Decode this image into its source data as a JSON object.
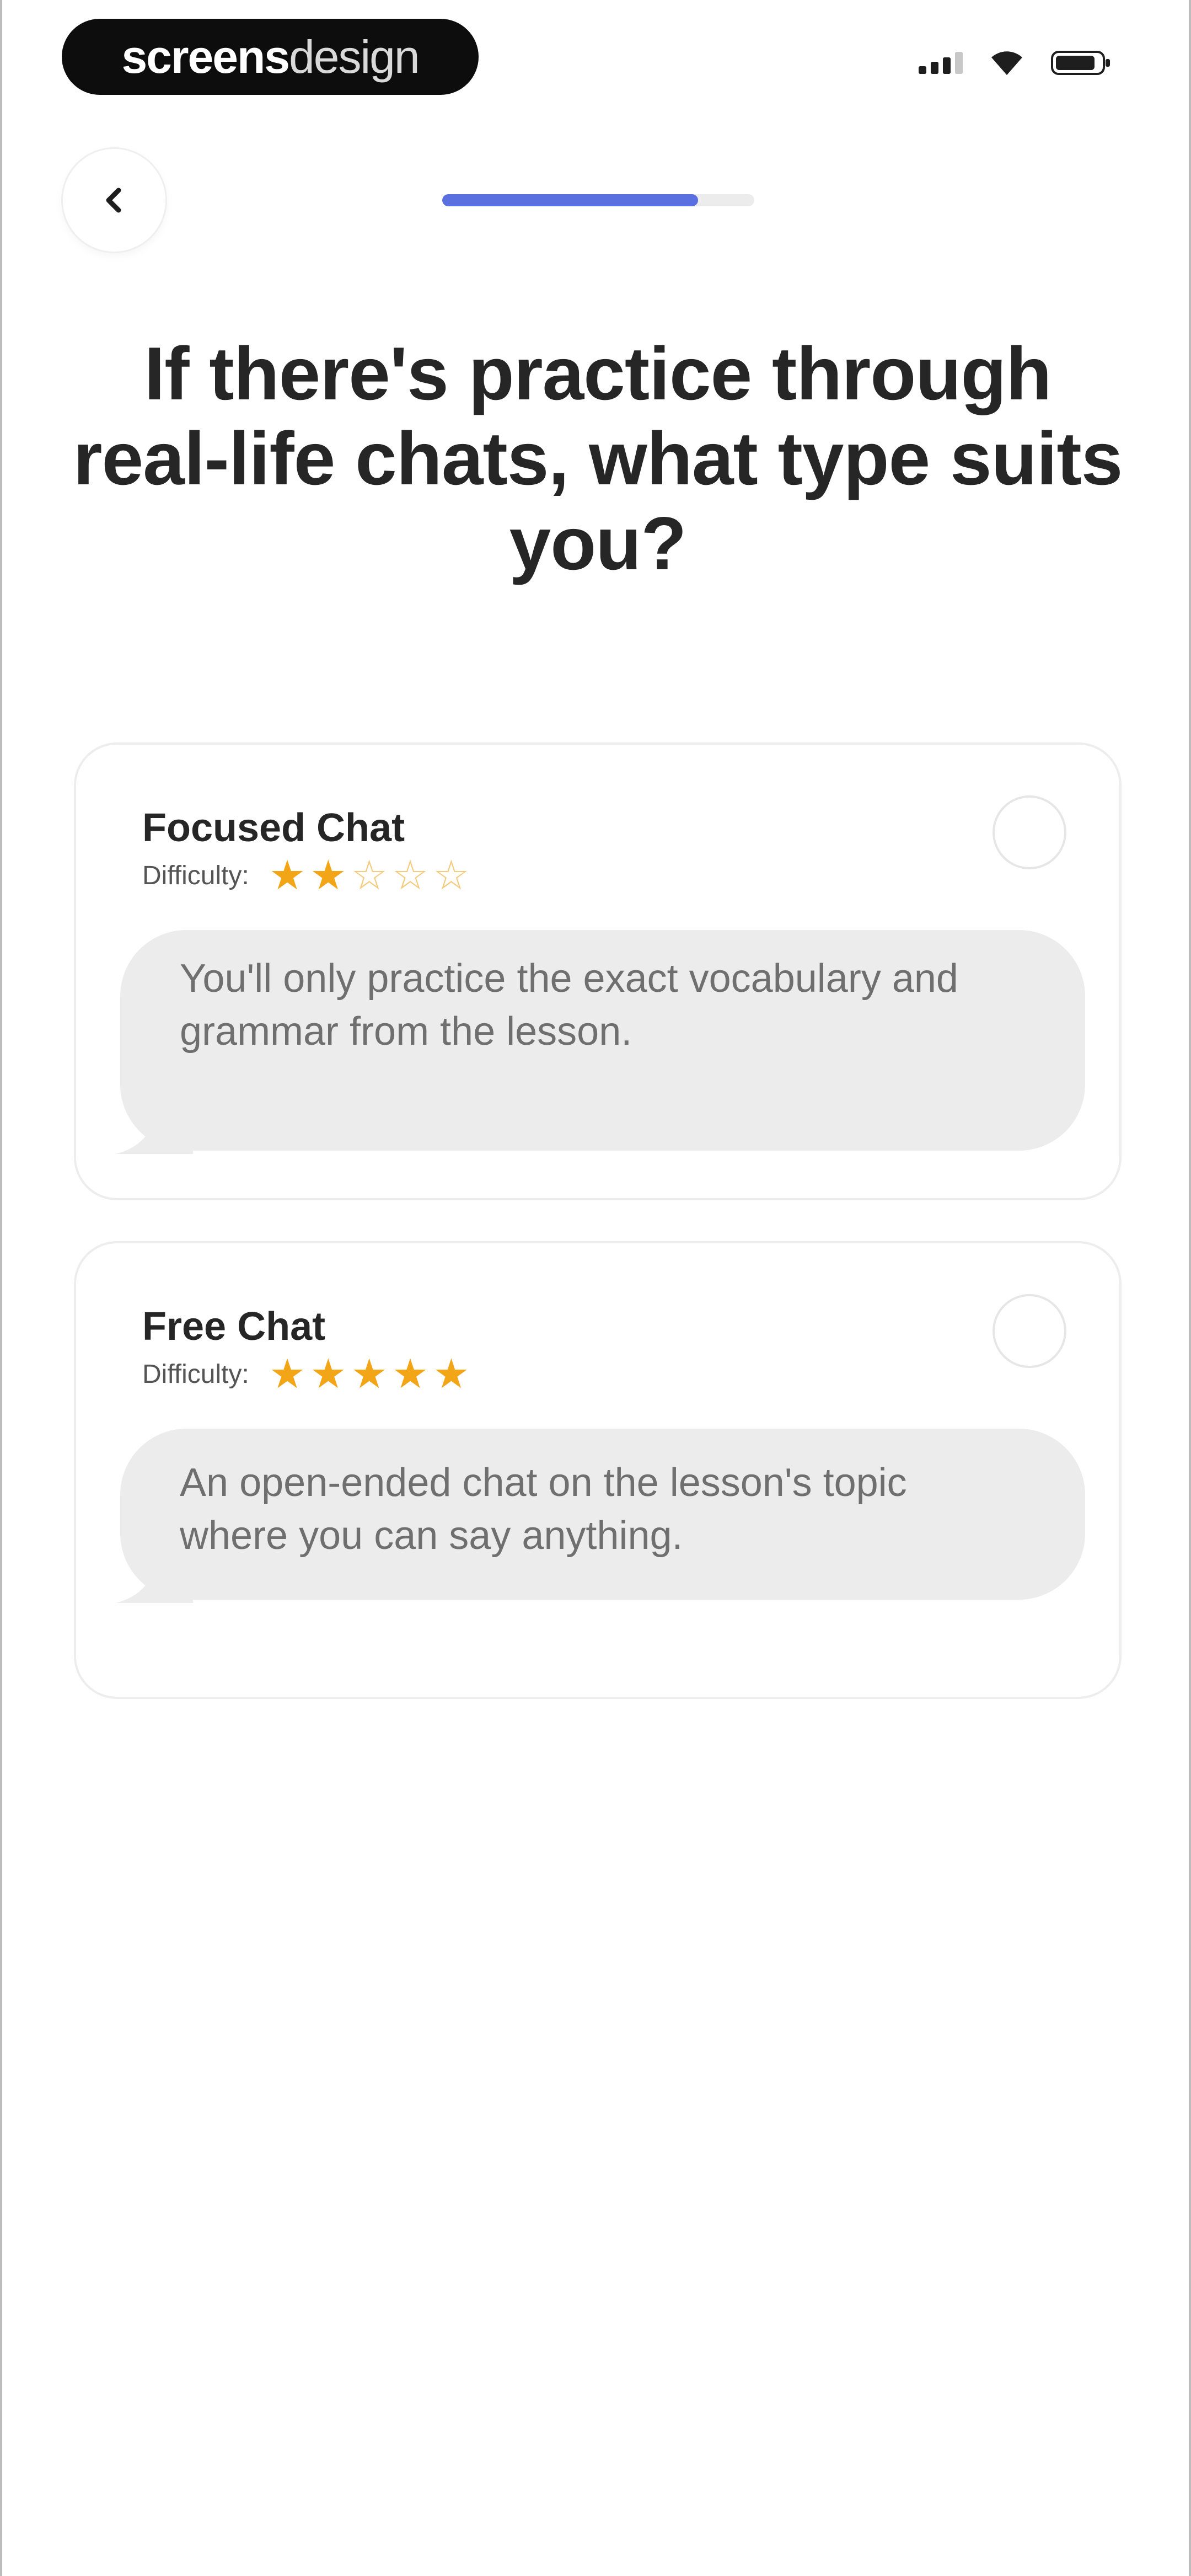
{
  "status_bar": {
    "brand_bold": "screens",
    "brand_light": "design",
    "icons": [
      "signal-icon",
      "wifi-icon",
      "battery-icon"
    ]
  },
  "nav": {
    "back_icon": "chevron-left-icon",
    "progress_fraction": 0.82
  },
  "question": {
    "title": "If there's practice through real-life chats, what type suits you?"
  },
  "options": [
    {
      "title": "Focused Chat",
      "difficulty_label": "Difficulty:",
      "difficulty_stars": 2,
      "max_stars": 5,
      "description": "You'll only practice the exact vocabulary and grammar from the lesson.",
      "selected": false
    },
    {
      "title": "Free Chat",
      "difficulty_label": "Difficulty:",
      "difficulty_stars": 5,
      "max_stars": 5,
      "description": "An open-ended chat on the lesson's topic where you can say anything.",
      "selected": false
    }
  ],
  "colors": {
    "accent": "#5a6fe0",
    "star": "#f2a516",
    "bubble": "#ececec"
  }
}
